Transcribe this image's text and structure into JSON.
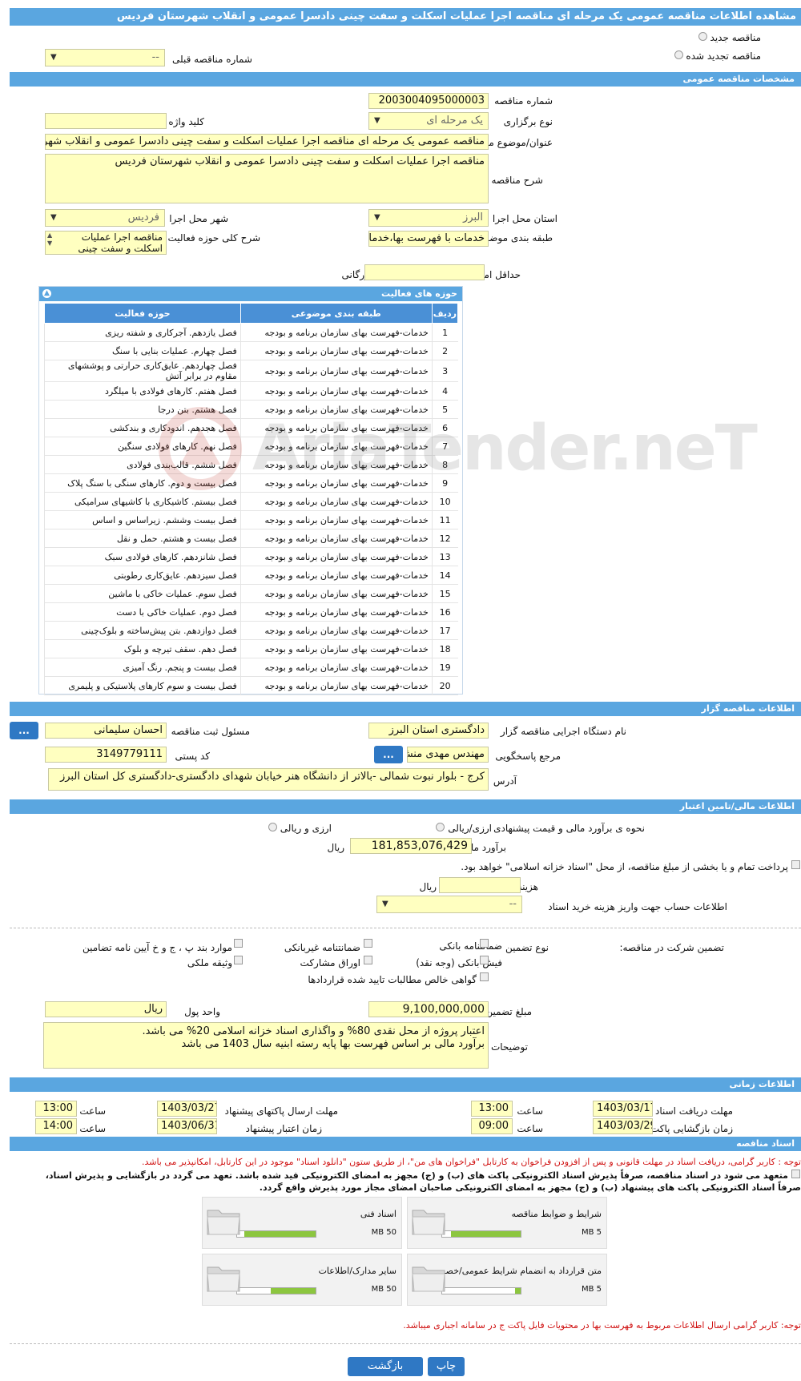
{
  "title": "مشاهده اطلاعات مناقصه عمومی یک مرحله ای مناقصه اجرا عملیات اسکلت و سفت چینی دادسرا عمومی و انقلاب شهرستان فردیس",
  "header": {
    "new_tender": "مناقصه جدید",
    "renewed_tender": "مناقصه تجدید شده",
    "prev_number_label": "شماره مناقصه قبلی",
    "prev_number_value": "--"
  },
  "general": {
    "section_title": "مشخصات مناقصه عمومی",
    "number_label": "شماره مناقصه",
    "number_value": "2003004095000003",
    "type_label": "نوع برگزاری",
    "type_value": "یک مرحله ای",
    "keyword_label": "کلید واژه",
    "keyword_value": "",
    "subject_label": "عنوان/موضوع مناقصه",
    "subject_value": "مناقصه عمومی یک مرحله ای مناقصه اجرا عملیات اسکلت و سفت چینی دادسرا عمومی و انقلاب شهرستان فردیس",
    "desc_label": "شرح مناقصه",
    "desc_value": "مناقصه اجرا عملیات اسکلت و سفت چینی دادسرا عمومی و انقلاب شهرستان فردیس",
    "province_label": "استان محل اجرا",
    "province_value": "البرز",
    "city_label": "شهر محل اجرا",
    "city_value": "فردیس",
    "category_label": "طبقه بندی موضوعی",
    "category_value": "خدمات با فهرست بها،خدمات",
    "scope_label": "شرح کلی حوزه فعالیت",
    "scope_value": "مناقصه اجرا عملیات اسکلت و سفت چینی",
    "min_score_label": "حداقل امتیاز قابل قبول ارزیابی فنی/بازرگانی",
    "min_score_value": ""
  },
  "activities": {
    "title": "حوزه های فعالیت",
    "col_row": "ردیف",
    "col_category": "طبقه بندی موضوعی",
    "col_activity": "حوزه فعالیت",
    "rows": [
      {
        "n": "1",
        "cat": "خدمات-فهرست بهای سازمان برنامه و بودجه",
        "act": "فصل یازدهم. آجرکاری و شفته ریزی"
      },
      {
        "n": "2",
        "cat": "خدمات-فهرست بهای سازمان برنامه و بودجه",
        "act": "فصل چهارم. عملیات بنایی با سنگ"
      },
      {
        "n": "3",
        "cat": "خدمات-فهرست بهای سازمان برنامه و بودجه",
        "act": "فصل چهاردهم. عایق‌کاری حرارتی و پوششهای مقاوم در برابر آتش"
      },
      {
        "n": "4",
        "cat": "خدمات-فهرست بهای سازمان برنامه و بودجه",
        "act": "فصل هفتم. کارهای فولادی با میلگرد"
      },
      {
        "n": "5",
        "cat": "خدمات-فهرست بهای سازمان برنامه و بودجه",
        "act": "فصل هشتم. بتن درجا"
      },
      {
        "n": "6",
        "cat": "خدمات-فهرست بهای سازمان برنامه و بودجه",
        "act": "فصل هجدهم. اندودکاری و بندکشی"
      },
      {
        "n": "7",
        "cat": "خدمات-فهرست بهای سازمان برنامه و بودجه",
        "act": "فصل نهم. کارهای فولادی سنگین"
      },
      {
        "n": "8",
        "cat": "خدمات-فهرست بهای سازمان برنامه و بودجه",
        "act": "فصل ششم. قالب‌بندی فولادی"
      },
      {
        "n": "9",
        "cat": "خدمات-فهرست بهای سازمان برنامه و بودجه",
        "act": "فصل بیست و دوم. کارهای سنگی با سنگ پلاک"
      },
      {
        "n": "10",
        "cat": "خدمات-فهرست بهای سازمان برنامه و بودجه",
        "act": "فصل بیستم. کاشیکاری با کاشیهای سرامیکی"
      },
      {
        "n": "11",
        "cat": "خدمات-فهرست بهای سازمان برنامه و بودجه",
        "act": "فصل بیست وششم. زیراساس و اساس"
      },
      {
        "n": "12",
        "cat": "خدمات-فهرست بهای سازمان برنامه و بودجه",
        "act": "فصل بیست و هشتم. حمل و نقل"
      },
      {
        "n": "13",
        "cat": "خدمات-فهرست بهای سازمان برنامه و بودجه",
        "act": "فصل شانزدهم. کارهای فولادی سبک"
      },
      {
        "n": "14",
        "cat": "خدمات-فهرست بهای سازمان برنامه و بودجه",
        "act": "فصل سیزدهم. عایق‌کاری رطوبتی"
      },
      {
        "n": "15",
        "cat": "خدمات-فهرست بهای سازمان برنامه و بودجه",
        "act": "فصل سوم. عملیات خاکی با ماشین"
      },
      {
        "n": "16",
        "cat": "خدمات-فهرست بهای سازمان برنامه و بودجه",
        "act": "فصل دوم. عملیات خاکی با دست"
      },
      {
        "n": "17",
        "cat": "خدمات-فهرست بهای سازمان برنامه و بودجه",
        "act": "فصل دوازدهم. بتن پیش‌ساخته و بلوک‌چینی"
      },
      {
        "n": "18",
        "cat": "خدمات-فهرست بهای سازمان برنامه و بودجه",
        "act": "فصل دهم. سقف تیرچه و بلوک"
      },
      {
        "n": "19",
        "cat": "خدمات-فهرست بهای سازمان برنامه و بودجه",
        "act": "فصل بیست و پنجم. رنگ آمیزی"
      },
      {
        "n": "20",
        "cat": "خدمات-فهرست بهای سازمان برنامه و بودجه",
        "act": "فصل بیست و سوم کارهای پلاستیکی و پلیمری"
      }
    ]
  },
  "organizer": {
    "section_title": "اطلاعات مناقصه گزار",
    "org_label": "نام دستگاه اجرایی مناقصه گزار",
    "org_value": "دادگستری استان البرز",
    "registrar_label": "مسئول ثبت مناقصه",
    "registrar_value": "احسان سلیمانی",
    "ref_label": "مرجع پاسخگویی",
    "ref_value": "مهندس مهدی منش",
    "postal_label": "کد پستی",
    "postal_value": "3149779111",
    "address_label": "آدرس",
    "address_value": "کرج - بلوار نبوت شمالی -بالاتر از دانشگاه هنر خیابان شهدای دادگستری-دادگستری کل استان البرز",
    "dots": "..."
  },
  "finance": {
    "section_title": "اطلاعات مالی/تامین اعتبار",
    "estimate_mode_label": "نحوه ی برآورد مالی و قیمت پیشنهادی",
    "mode_rial": "ارزی/ریالی",
    "mode_fx": "ارزی و ریالی",
    "estimate_label": "برآورد مالی",
    "estimate_value": "181,853,076,429",
    "rial": "ریال",
    "treasury_note": "پرداخت تمام و یا بخشی از مبلغ مناقصه، از محل \"اسناد خزانه اسلامی\" خواهد بود.",
    "doc_cost_label": "هزینه خرید اسناد",
    "doc_cost_value": "",
    "account_label": "اطلاعات حساب جهت واریز هزینه خرید اسناد",
    "account_value": "--"
  },
  "guarantee": {
    "title_label": "تضمین شرکت در مناقصه:",
    "type_label": "نوع تضمین",
    "opt_bank": "ضمانتنامه بانکی",
    "opt_nonbank": "ضمانتنامه غیربانکی",
    "opt_clauses": "موارد بند پ ، ج و خ آیین نامه تضامین",
    "opt_cash": "فیش بانکی (وجه نقد)",
    "opt_bonds": "اوراق مشارکت",
    "opt_property": "وثیقه ملکی",
    "opt_claims": "گواهی خالص مطالبات تایید شده قراردادها",
    "amount_label": "مبلغ تضمین",
    "amount_value": "9,100,000,000",
    "currency_label": "واحد پول",
    "currency_value": "ریال",
    "notes_label": "توضیحات",
    "notes_line1": "اعتبار پروژه از محل نقدی  80%  و واگذاری اسناد خزانه اسلامی 20% می باشد.",
    "notes_line2": "برآورد مالی بر اساس فهرست بها پایه رسته ابنیه سال 1403 می باشد"
  },
  "timing": {
    "section_title": "اطلاعات زمانی",
    "receive_label": "مهلت دریافت اسناد",
    "receive_date": "1403/03/17",
    "time_label": "ساعت",
    "receive_time": "13:00",
    "send_label": "مهلت ارسال پاکتهای پیشنهاد",
    "send_date": "1403/03/27",
    "send_time": "13:00",
    "open_label": "زمان بازگشایی پاکت ها",
    "open_date": "1403/03/29",
    "open_time": "09:00",
    "validity_label": "زمان اعتبار پیشنهاد",
    "validity_date": "1403/06/31",
    "validity_time": "14:00"
  },
  "documents": {
    "section_title": "اسناد مناقصه",
    "note_red": "توجه : کاربر گرامی، دریافت اسناد در مهلت قانونی و پس از افزودن فراخوان به کارتابل \"فراخوان های من\"، از طریق ستون \"دانلود اسناد\" موجود در این کارتابل، امکانپذیر می باشد.",
    "note_bold1": "متعهد می شود در اسناد مناقصه، صرفاً پذیرش اسناد الکترونیکی پاکت های (ب) و (ج) مجهز به امضای الکترونیکی قید شده باشد. تعهد می گردد در بازگشایی و پذیرش اسناد،",
    "note_bold2": "صرفاً اسناد الکترونیکی پاکت های پیشنهاد (ب) و (ج) مجهز به امضای الکترونیکی صاحبان امضای مجاز مورد پذیرش واقع گردد.",
    "cards": [
      {
        "title": "شرایط و ضوابط مناقصه",
        "used": "4.44 MB",
        "max": "5 MB",
        "fill": 0.89
      },
      {
        "title": "اسناد فنی",
        "used": "45.4 MB",
        "max": "50 MB",
        "fill": 0.91
      },
      {
        "title": "متن قرارداد به انضمام شرایط عمومی/خصوصی",
        "used": "376 KB",
        "max": "5 MB",
        "fill": 0.07
      },
      {
        "title": "سایر مدارک/اطلاعات",
        "used": "28.4 MB",
        "max": "50 MB",
        "fill": 0.57
      }
    ],
    "note_red2": "توجه: کاربر گرامی ارسال اطلاعات مربوط به فهرست بها در محتویات فایل پاکت ج در سامانه اجباری میباشد."
  },
  "footer": {
    "print": "چاپ",
    "back": "بازگشت"
  },
  "watermark": "AriaTender.neT"
}
